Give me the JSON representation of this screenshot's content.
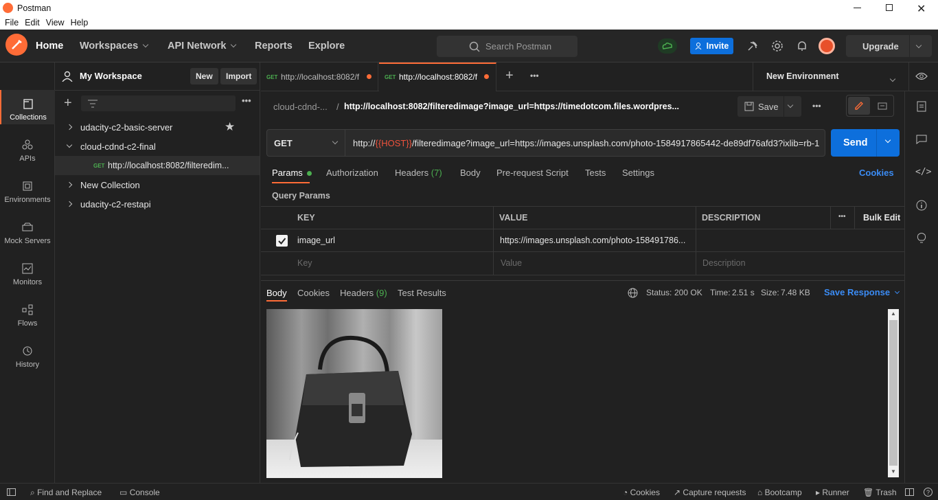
{
  "app": {
    "title": "Postman"
  },
  "menu": [
    "File",
    "Edit",
    "View",
    "Help"
  ],
  "header": {
    "home": "Home",
    "workspaces": "Workspaces",
    "api_network": "API Network",
    "reports": "Reports",
    "explore": "Explore",
    "search_placeholder": "Search Postman",
    "invite": "Invite",
    "upgrade": "Upgrade"
  },
  "workspace": {
    "name": "My Workspace",
    "new_label": "New",
    "import_label": "Import"
  },
  "rail": [
    "Collections",
    "APIs",
    "Environments",
    "Mock Servers",
    "Monitors",
    "Flows",
    "History"
  ],
  "collections": [
    {
      "name": "udacity-c2-basic-server"
    },
    {
      "name": "cloud-cdnd-c2-final",
      "request": {
        "method": "GET",
        "name": "http://localhost:8082/filteredim..."
      }
    },
    {
      "name": "New Collection"
    },
    {
      "name": "udacity-c2-restapi"
    }
  ],
  "tabs": [
    {
      "method": "GET",
      "label": "http://localhost:8082/f"
    },
    {
      "method": "GET",
      "label": "http://localhost:8082/f"
    }
  ],
  "environment": "New Environment",
  "request": {
    "breadcrumb_parent": "cloud-cdnd-...",
    "breadcrumb_sep": "/",
    "breadcrumb_title": "http://localhost:8082/filteredimage?image_url=https://timedotcom.files.wordpres...",
    "save_label": "Save",
    "method": "GET",
    "url_prefix": "http://",
    "url_var": "{{HOST}}",
    "url_rest": "/filteredimage?image_url=https://images.unsplash.com/photo-1584917865442-de89df76afd3?ixlib=rb-1",
    "send_label": "Send"
  },
  "request_tabs": {
    "params": "Params",
    "authorization": "Authorization",
    "headers": "Headers",
    "headers_count": "(7)",
    "body": "Body",
    "prerequest": "Pre-request Script",
    "tests": "Tests",
    "settings": "Settings",
    "cookies": "Cookies"
  },
  "query_params": {
    "title": "Query Params",
    "col_key": "KEY",
    "col_value": "VALUE",
    "col_description": "DESCRIPTION",
    "bulk_edit": "Bulk Edit",
    "row": {
      "key": "image_url",
      "value": "https://images.unsplash.com/photo-158491786...",
      "checked": true
    },
    "placeholder_key": "Key",
    "placeholder_value": "Value",
    "placeholder_description": "Description"
  },
  "response": {
    "tab_body": "Body",
    "tab_cookies": "Cookies",
    "tab_headers": "Headers",
    "headers_count": "(9)",
    "tab_tests": "Test Results",
    "status_label": "Status:",
    "status_value": "200 OK",
    "time_label": "Time:",
    "time_value": "2.51 s",
    "size_label": "Size:",
    "size_value": "7.48 KB",
    "save_response": "Save Response"
  },
  "footer": {
    "find_replace": "Find and Replace",
    "console": "Console",
    "cookies": "Cookies",
    "capture": "Capture requests",
    "bootcamp": "Bootcamp",
    "runner": "Runner",
    "trash": "Trash"
  },
  "colors": {
    "accent": "#ff6c37",
    "primary": "#0d6fdc",
    "success": "#4caf50",
    "link": "#3b8cf5"
  }
}
